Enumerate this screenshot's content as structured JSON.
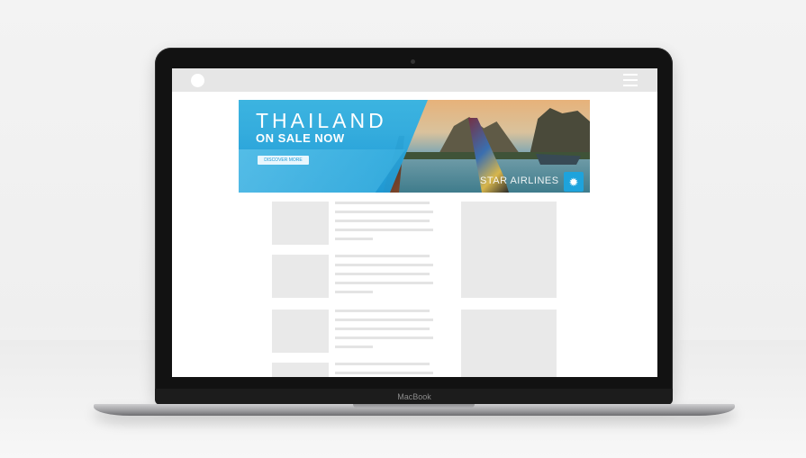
{
  "device": {
    "brand_label": "MacBook"
  },
  "website": {
    "topbar": {
      "logo_icon": "circle-logo-icon",
      "menu_icon": "hamburger-menu-icon"
    },
    "banner": {
      "title": "THAILAND",
      "subtitle": "ON SALE NOW",
      "cta_label": "DISCOVER MORE",
      "brand_label": "STAR AIRLINES",
      "badge_icon": "sun-icon",
      "colors": {
        "primary_blue": "#1e9ad6",
        "light_blue": "#64c6ec"
      }
    },
    "content": {
      "article_rows": 4,
      "sidebar_blocks": 2
    }
  }
}
